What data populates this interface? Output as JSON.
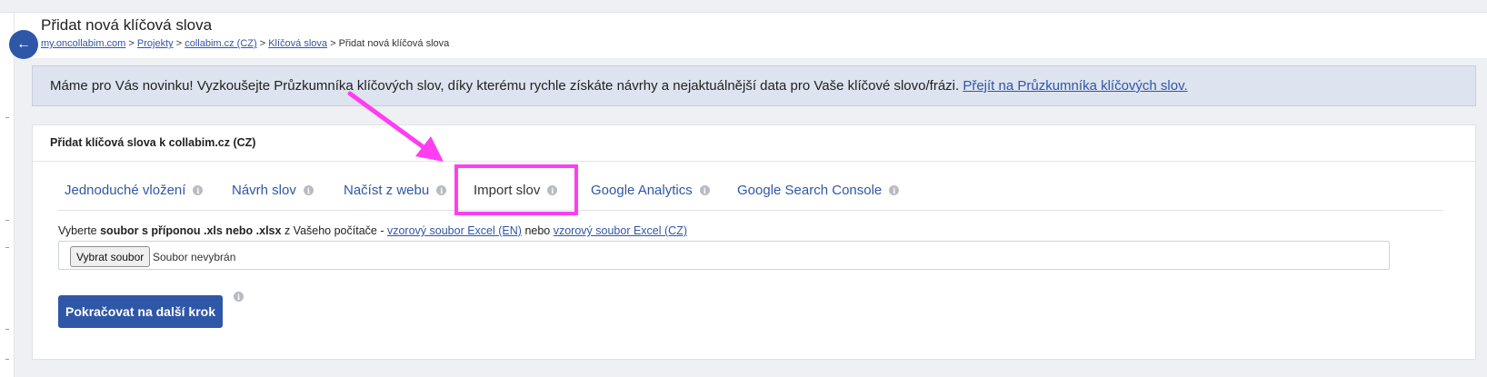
{
  "header": {
    "back_icon": "arrow-left-icon",
    "title": "Přidat nová klíčová slova"
  },
  "breadcrumb": [
    {
      "label": "my.oncollabim.com",
      "link": true
    },
    {
      "label": "Projekty",
      "link": true
    },
    {
      "label": "collabim.cz (CZ)",
      "link": true
    },
    {
      "label": "Klíčová slova",
      "link": true
    },
    {
      "label": "Přidat nová klíčová slova",
      "link": false
    }
  ],
  "breadcrumb_separator": ">",
  "notice": {
    "text": "Máme pro Vás novinku! Vyzkoušejte Průzkumníka klíčových slov, díky kterému rychle získáte návrhy a nejaktuálnější data pro Vaše klíčové slovo/frázi.",
    "link": "Přejít na Průzkumníka klíčových slov."
  },
  "card": {
    "title": "Přidat klíčová slova k collabim.cz (CZ)"
  },
  "tabs": [
    {
      "label": "Jednoduché vložení",
      "active": false
    },
    {
      "label": "Návrh slov",
      "active": false
    },
    {
      "label": "Načíst z webu",
      "active": false
    },
    {
      "label": "Import slov",
      "active": true
    },
    {
      "label": "Google Analytics",
      "active": false
    },
    {
      "label": "Google Search Console",
      "active": false
    }
  ],
  "import": {
    "label_prefix": "Vyberte",
    "label_bold": "soubor s příponou .xls nebo .xlsx",
    "label_middle": "z Vašeho počítače -",
    "link_en": "vzorový soubor Excel (EN)",
    "label_or": "nebo",
    "link_cz": "vzorový soubor Excel (CZ)",
    "file_button": "Vybrat soubor",
    "file_status": "Soubor nevybrán"
  },
  "continue_button": "Pokračovat na další krok",
  "info_icon_glyph": "i",
  "colors": {
    "primary": "#2f57a7",
    "annotation": "#ff3ef2",
    "notice_bg": "#dde3ef"
  }
}
